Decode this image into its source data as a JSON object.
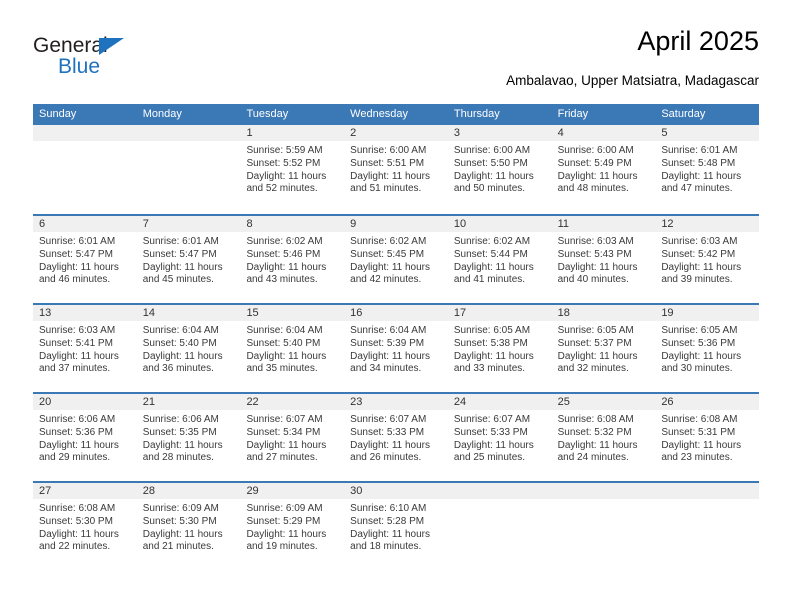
{
  "logo": {
    "word_one": "General",
    "word_two": "Blue",
    "triangle_color": "#1f72bd"
  },
  "header": {
    "title": "April 2025",
    "subtitle": "Ambalavao, Upper Matsiatra, Madagascar"
  },
  "theme": {
    "header_blue": "#3b78b6",
    "day_band_gray": "#f0f0f0",
    "text": "#3a3a3a"
  },
  "calendar": {
    "weekdays": [
      "Sunday",
      "Monday",
      "Tuesday",
      "Wednesday",
      "Thursday",
      "Friday",
      "Saturday"
    ],
    "weeks": [
      [
        {
          "day": "",
          "lines": []
        },
        {
          "day": "",
          "lines": []
        },
        {
          "day": "1",
          "lines": [
            "Sunrise: 5:59 AM",
            "Sunset: 5:52 PM",
            "Daylight: 11 hours",
            "and 52 minutes."
          ]
        },
        {
          "day": "2",
          "lines": [
            "Sunrise: 6:00 AM",
            "Sunset: 5:51 PM",
            "Daylight: 11 hours",
            "and 51 minutes."
          ]
        },
        {
          "day": "3",
          "lines": [
            "Sunrise: 6:00 AM",
            "Sunset: 5:50 PM",
            "Daylight: 11 hours",
            "and 50 minutes."
          ]
        },
        {
          "day": "4",
          "lines": [
            "Sunrise: 6:00 AM",
            "Sunset: 5:49 PM",
            "Daylight: 11 hours",
            "and 48 minutes."
          ]
        },
        {
          "day": "5",
          "lines": [
            "Sunrise: 6:01 AM",
            "Sunset: 5:48 PM",
            "Daylight: 11 hours",
            "and 47 minutes."
          ]
        }
      ],
      [
        {
          "day": "6",
          "lines": [
            "Sunrise: 6:01 AM",
            "Sunset: 5:47 PM",
            "Daylight: 11 hours",
            "and 46 minutes."
          ]
        },
        {
          "day": "7",
          "lines": [
            "Sunrise: 6:01 AM",
            "Sunset: 5:47 PM",
            "Daylight: 11 hours",
            "and 45 minutes."
          ]
        },
        {
          "day": "8",
          "lines": [
            "Sunrise: 6:02 AM",
            "Sunset: 5:46 PM",
            "Daylight: 11 hours",
            "and 43 minutes."
          ]
        },
        {
          "day": "9",
          "lines": [
            "Sunrise: 6:02 AM",
            "Sunset: 5:45 PM",
            "Daylight: 11 hours",
            "and 42 minutes."
          ]
        },
        {
          "day": "10",
          "lines": [
            "Sunrise: 6:02 AM",
            "Sunset: 5:44 PM",
            "Daylight: 11 hours",
            "and 41 minutes."
          ]
        },
        {
          "day": "11",
          "lines": [
            "Sunrise: 6:03 AM",
            "Sunset: 5:43 PM",
            "Daylight: 11 hours",
            "and 40 minutes."
          ]
        },
        {
          "day": "12",
          "lines": [
            "Sunrise: 6:03 AM",
            "Sunset: 5:42 PM",
            "Daylight: 11 hours",
            "and 39 minutes."
          ]
        }
      ],
      [
        {
          "day": "13",
          "lines": [
            "Sunrise: 6:03 AM",
            "Sunset: 5:41 PM",
            "Daylight: 11 hours",
            "and 37 minutes."
          ]
        },
        {
          "day": "14",
          "lines": [
            "Sunrise: 6:04 AM",
            "Sunset: 5:40 PM",
            "Daylight: 11 hours",
            "and 36 minutes."
          ]
        },
        {
          "day": "15",
          "lines": [
            "Sunrise: 6:04 AM",
            "Sunset: 5:40 PM",
            "Daylight: 11 hours",
            "and 35 minutes."
          ]
        },
        {
          "day": "16",
          "lines": [
            "Sunrise: 6:04 AM",
            "Sunset: 5:39 PM",
            "Daylight: 11 hours",
            "and 34 minutes."
          ]
        },
        {
          "day": "17",
          "lines": [
            "Sunrise: 6:05 AM",
            "Sunset: 5:38 PM",
            "Daylight: 11 hours",
            "and 33 minutes."
          ]
        },
        {
          "day": "18",
          "lines": [
            "Sunrise: 6:05 AM",
            "Sunset: 5:37 PM",
            "Daylight: 11 hours",
            "and 32 minutes."
          ]
        },
        {
          "day": "19",
          "lines": [
            "Sunrise: 6:05 AM",
            "Sunset: 5:36 PM",
            "Daylight: 11 hours",
            "and 30 minutes."
          ]
        }
      ],
      [
        {
          "day": "20",
          "lines": [
            "Sunrise: 6:06 AM",
            "Sunset: 5:36 PM",
            "Daylight: 11 hours",
            "and 29 minutes."
          ]
        },
        {
          "day": "21",
          "lines": [
            "Sunrise: 6:06 AM",
            "Sunset: 5:35 PM",
            "Daylight: 11 hours",
            "and 28 minutes."
          ]
        },
        {
          "day": "22",
          "lines": [
            "Sunrise: 6:07 AM",
            "Sunset: 5:34 PM",
            "Daylight: 11 hours",
            "and 27 minutes."
          ]
        },
        {
          "day": "23",
          "lines": [
            "Sunrise: 6:07 AM",
            "Sunset: 5:33 PM",
            "Daylight: 11 hours",
            "and 26 minutes."
          ]
        },
        {
          "day": "24",
          "lines": [
            "Sunrise: 6:07 AM",
            "Sunset: 5:33 PM",
            "Daylight: 11 hours",
            "and 25 minutes."
          ]
        },
        {
          "day": "25",
          "lines": [
            "Sunrise: 6:08 AM",
            "Sunset: 5:32 PM",
            "Daylight: 11 hours",
            "and 24 minutes."
          ]
        },
        {
          "day": "26",
          "lines": [
            "Sunrise: 6:08 AM",
            "Sunset: 5:31 PM",
            "Daylight: 11 hours",
            "and 23 minutes."
          ]
        }
      ],
      [
        {
          "day": "27",
          "lines": [
            "Sunrise: 6:08 AM",
            "Sunset: 5:30 PM",
            "Daylight: 11 hours",
            "and 22 minutes."
          ]
        },
        {
          "day": "28",
          "lines": [
            "Sunrise: 6:09 AM",
            "Sunset: 5:30 PM",
            "Daylight: 11 hours",
            "and 21 minutes."
          ]
        },
        {
          "day": "29",
          "lines": [
            "Sunrise: 6:09 AM",
            "Sunset: 5:29 PM",
            "Daylight: 11 hours",
            "and 19 minutes."
          ]
        },
        {
          "day": "30",
          "lines": [
            "Sunrise: 6:10 AM",
            "Sunset: 5:28 PM",
            "Daylight: 11 hours",
            "and 18 minutes."
          ]
        },
        {
          "day": "",
          "lines": []
        },
        {
          "day": "",
          "lines": []
        },
        {
          "day": "",
          "lines": []
        }
      ]
    ]
  }
}
